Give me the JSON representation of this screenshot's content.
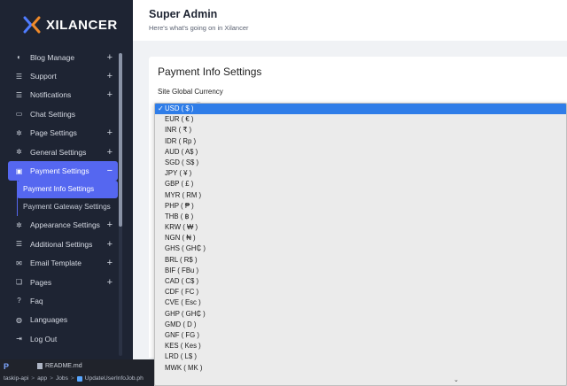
{
  "brand": {
    "name": "XILANCER",
    "accent": "#5567f0",
    "logo_color": "#4f7cff"
  },
  "header": {
    "title": "Super Admin",
    "subtitle": "Here's what's going on in Xilancer"
  },
  "sidebar": {
    "items": [
      {
        "label": "Blog Manage",
        "icon": "blog-icon",
        "expandable": true
      },
      {
        "label": "Support",
        "icon": "list-icon",
        "expandable": true
      },
      {
        "label": "Notifications",
        "icon": "list-icon",
        "expandable": true
      },
      {
        "label": "Chat Settings",
        "icon": "chat-icon",
        "expandable": false
      },
      {
        "label": "Page Settings",
        "icon": "gear-icon",
        "expandable": true
      },
      {
        "label": "General Settings",
        "icon": "gear-icon",
        "expandable": true
      },
      {
        "label": "Payment Settings",
        "icon": "wallet-icon",
        "expandable": true,
        "active": true,
        "expanded": true
      },
      {
        "label": "Appearance Settings",
        "icon": "gear-icon",
        "expandable": true
      },
      {
        "label": "Additional Settings",
        "icon": "list-icon",
        "expandable": true
      },
      {
        "label": "Email Template",
        "icon": "mail-icon",
        "expandable": true
      },
      {
        "label": "Pages",
        "icon": "pages-icon",
        "expandable": true
      },
      {
        "label": "Faq",
        "icon": "question-icon",
        "expandable": false
      },
      {
        "label": "Languages",
        "icon": "globe-icon",
        "expandable": false
      },
      {
        "label": "Log Out",
        "icon": "logout-icon",
        "expandable": false
      }
    ],
    "payment_sub": [
      {
        "label": "Payment Info Settings",
        "active": true
      },
      {
        "label": "Payment Gateway Settings",
        "active": false
      }
    ],
    "plus": "+",
    "minus": "−"
  },
  "card": {
    "title": "Payment Info Settings",
    "field_label": "Site Global Currency"
  },
  "currency_dropdown": {
    "selected": "USD ( $ )",
    "check": "✓",
    "options": [
      "USD ( $ )",
      "EUR ( € )",
      "INR ( ₹ )",
      "IDR ( Rp )",
      "AUD ( A$ )",
      "SGD ( S$ )",
      "JPY ( ¥ )",
      "GBP ( £ )",
      "MYR ( RM )",
      "PHP ( ₱ )",
      "THB ( ฿ )",
      "KRW ( ₩ )",
      "NGN ( ₦ )",
      "GHS ( GH₵ )",
      "BRL ( R$ )",
      "BIF ( FBu )",
      "CAD ( C$ )",
      "CDF ( FC )",
      "CVE ( Esc )",
      "GHP ( GH₵ )",
      "GMD ( D )",
      "GNF ( FG )",
      "KES ( Kes )",
      "LRD ( L$ )",
      "MWK ( MK )"
    ],
    "more_arrow": "⌄"
  },
  "statusbar": {
    "logo": "P",
    "file": "README.md",
    "breadcrumb": [
      "taskip-api",
      "app",
      "Jobs",
      "UpdateUserInfoJob.ph"
    ],
    "sep": ">"
  }
}
